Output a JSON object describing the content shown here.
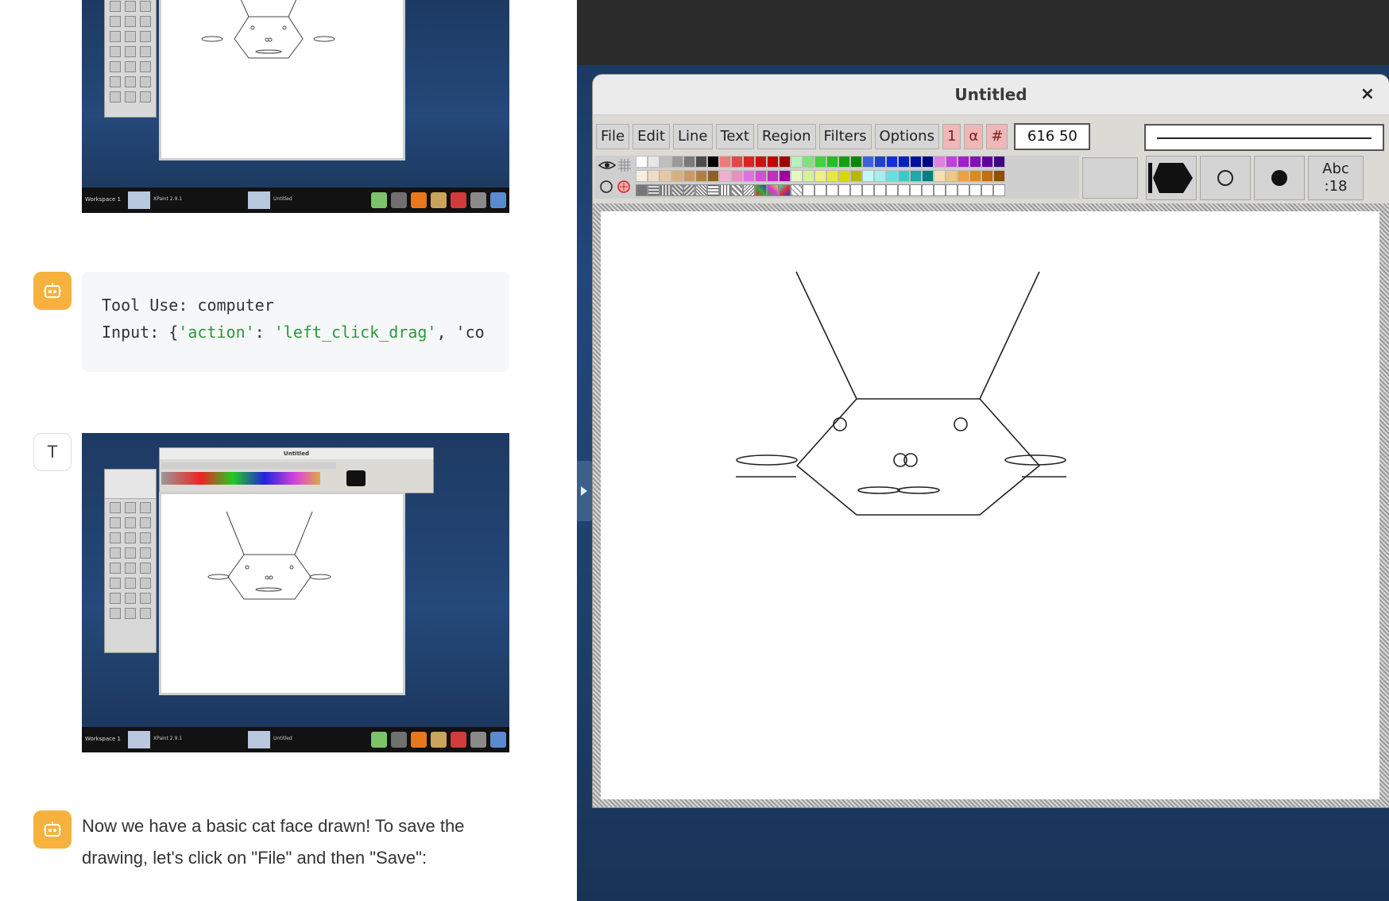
{
  "chat": {
    "tool_call": {
      "line1": "Tool Use: computer",
      "line2_prefix": "Input: {",
      "line2_key": "'action'",
      "line2_sep": ": ",
      "line2_value": "'left_click_drag'",
      "line2_rest": ", 'co"
    },
    "user_avatar_label": "T",
    "assistant_message": "Now we have a basic cat face drawn! To save the drawing, let's click on \"File\" and then \"Save\":",
    "thumbnail_taskbar": {
      "workspace": "Workspace 1",
      "app1": "XPaint 2.9.1",
      "app2": "Untitled"
    },
    "thumbnail_window_title": "Untitled"
  },
  "xpaint": {
    "window_title": "Untitled",
    "close_symbol": "×",
    "menu": [
      "File",
      "Edit",
      "Line",
      "Text",
      "Region",
      "Filters",
      "Options"
    ],
    "toggle_buttons": [
      "1",
      "α",
      "#"
    ],
    "coordinates": "616 50",
    "font_button": {
      "line1": "Abc",
      "line2": ":18"
    },
    "palette_row1": [
      "#ffffff",
      "#e6e6e6",
      "#bfbfbf",
      "#9a9a9a",
      "#7a7a7a",
      "#4c4c4c",
      "#000000",
      "#f07a7a",
      "#e84545",
      "#e02020",
      "#d01010",
      "#c40000",
      "#a00000",
      "#b8f0b8",
      "#80e080",
      "#40d040",
      "#20c020",
      "#10a010",
      "#008800",
      "#4060e0",
      "#2040d0",
      "#1030e0",
      "#0020c0",
      "#0010a0",
      "#00008a",
      "#e080e0",
      "#c040e0",
      "#a020d0",
      "#8010c0",
      "#6000a0",
      "#400080"
    ],
    "palette_row2": [
      "#f7efe2",
      "#efdcc4",
      "#e6c8a4",
      "#d8b080",
      "#c89a66",
      "#b08040",
      "#906020",
      "#f0b0d0",
      "#e890c0",
      "#e070e0",
      "#d050d0",
      "#c030c0",
      "#a000a0",
      "#e6f7c0",
      "#d6f0a0",
      "#f0f080",
      "#e8e840",
      "#d8d800",
      "#b8b800",
      "#c0f7f7",
      "#a0f0f0",
      "#60e0e0",
      "#40c8c8",
      "#20a8a8",
      "#008080",
      "#f7e0b0",
      "#f0c880",
      "#f0a040",
      "#e08820",
      "#c07010",
      "#905000"
    ],
    "accent_pink": "#efb7b7"
  }
}
